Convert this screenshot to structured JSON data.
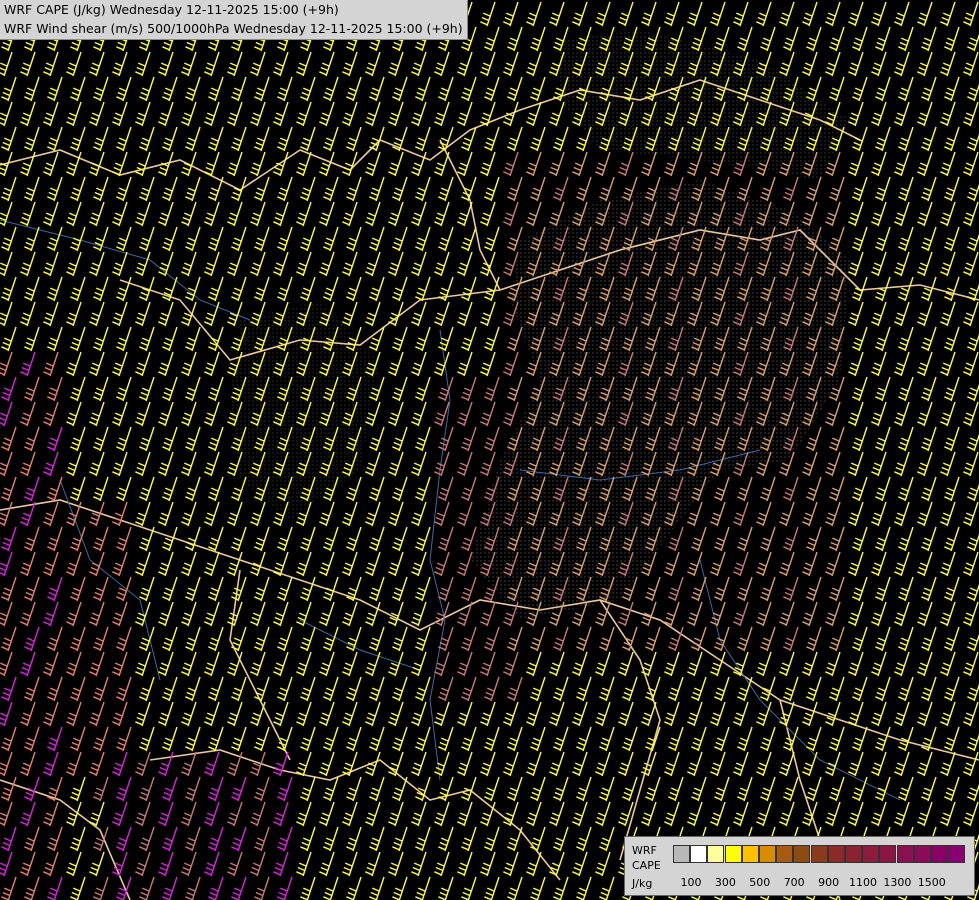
{
  "header": {
    "line1": "WRF CAPE (J/kg) Wednesday 12-11-2025 15:00 (+9h)",
    "line2": "WRF Wind shear (m/s) 500/1000hPa Wednesday 12-11-2025 15:00 (+9h)"
  },
  "legend": {
    "label_line1": "WRF",
    "label_line2": "CAPE",
    "label_line3": "J/kg",
    "colors": [
      "#b8b8b8",
      "#ffffff",
      "#ffff99",
      "#ffff00",
      "#ffc000",
      "#d98c00",
      "#a85a10",
      "#8c4a14",
      "#8b3a1e",
      "#8b2a28",
      "#8b2232",
      "#8b1c3c",
      "#8b1646",
      "#8b1050",
      "#8b0a5a",
      "#8b0064",
      "#8b0070"
    ],
    "ticks": [
      "100",
      "300",
      "500",
      "700",
      "900",
      "1100",
      "1300",
      "1500"
    ]
  },
  "map": {
    "barb_colors": {
      "low": "#ffff33",
      "mid": "#d9a06a",
      "salmon": "#e8806a",
      "pink": "#c87878",
      "magenta": "#dd22dd"
    },
    "border_color": "#e8c8a0",
    "river_color": "#3a6aa8"
  }
}
